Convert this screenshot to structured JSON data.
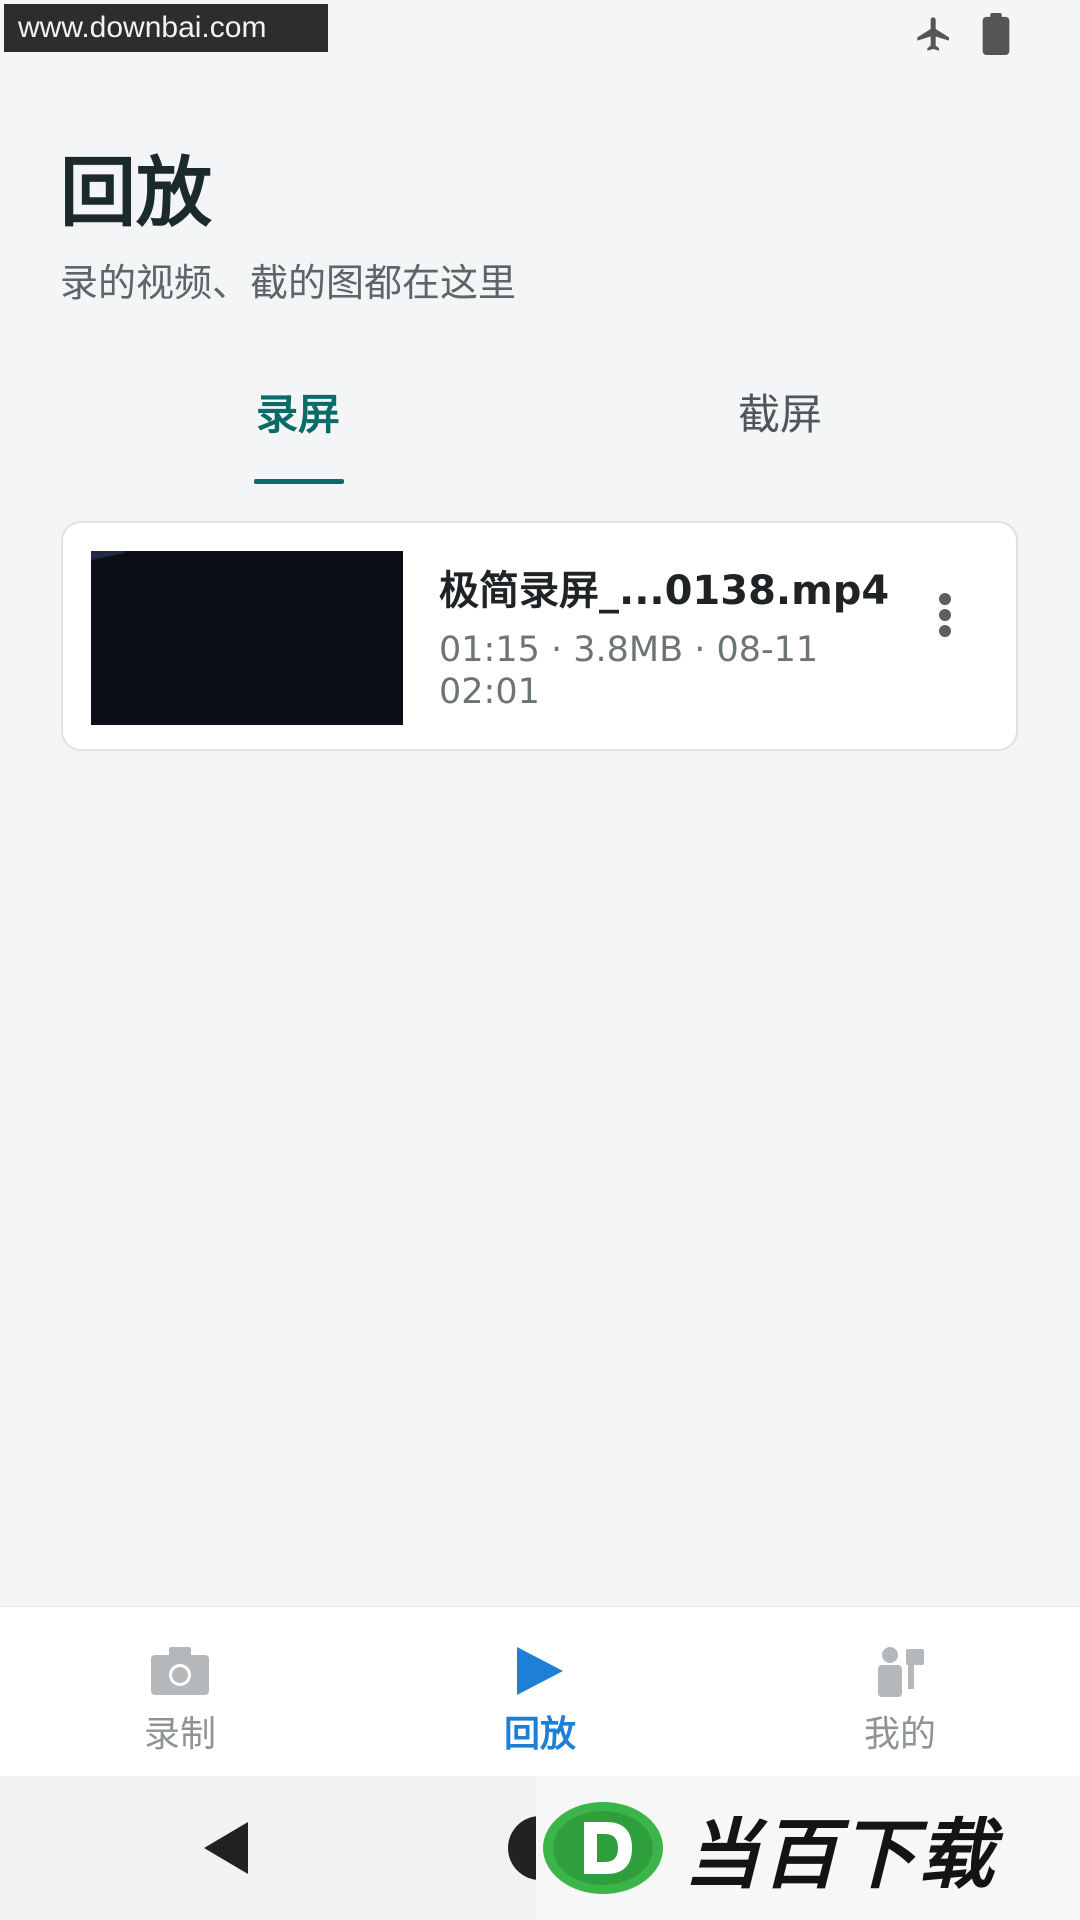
{
  "status_bar": {
    "watermark_text": "www.downbai.com",
    "icons": [
      "airplane-mode-icon",
      "battery-icon"
    ]
  },
  "header": {
    "title": "回放",
    "subtitle": "录的视频、截的图都在这里"
  },
  "tabs": [
    {
      "label": "录屏",
      "selected": true
    },
    {
      "label": "截屏",
      "selected": false
    }
  ],
  "files": [
    {
      "name": "极简录屏_...0138.mp4",
      "meta": "01:15 · 3.8MB · 08-11 02:01",
      "menu_icon": "more-vertical-icon"
    }
  ],
  "bottom_nav": {
    "items": [
      {
        "label": "录制",
        "icon": "camera-icon",
        "active": false
      },
      {
        "label": "回放",
        "icon": "play-icon",
        "active": true
      },
      {
        "label": "我的",
        "icon": "user-icon",
        "active": false
      }
    ]
  },
  "colors": {
    "accent_tab": "#0b6b66",
    "accent_nav": "#1e7fd6",
    "inactive": "#8e9394",
    "background": "#f4f5f7"
  },
  "system_nav": {
    "icons": [
      "back-icon",
      "home-icon"
    ]
  },
  "brand_overlay": {
    "text": "当百下载",
    "logo_letter": "D"
  }
}
